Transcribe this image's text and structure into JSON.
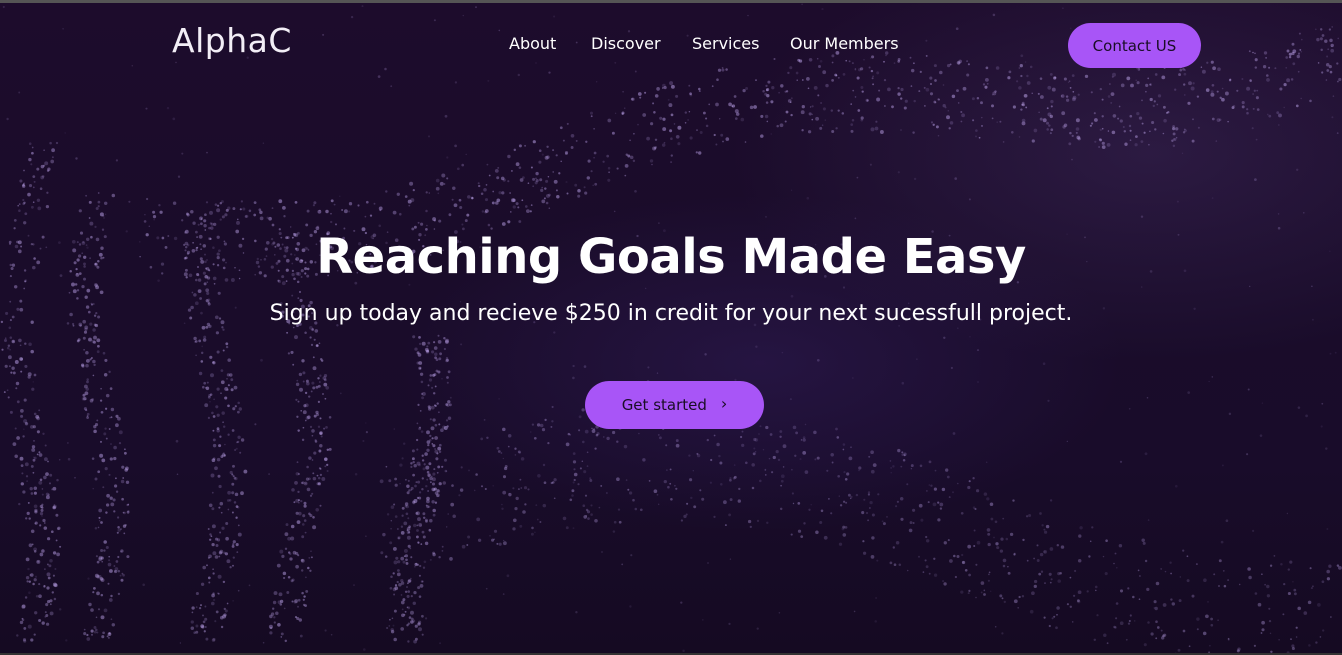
{
  "brand": {
    "logo": "AlphaC"
  },
  "nav": {
    "links": [
      "About",
      "Discover",
      "Services",
      "Our Members"
    ],
    "contact_label": "Contact US"
  },
  "hero": {
    "title": "Reaching Goals Made Easy",
    "subtitle": "Sign up today and recieve $250 in credit for your next sucessfull project.",
    "cta_label": "Get started",
    "cta_icon": "chevron-right-icon"
  },
  "colors": {
    "accent": "#a855f7",
    "background": "#1a0c2a",
    "particles": "#b9a0e6",
    "text": "#ffffff"
  }
}
